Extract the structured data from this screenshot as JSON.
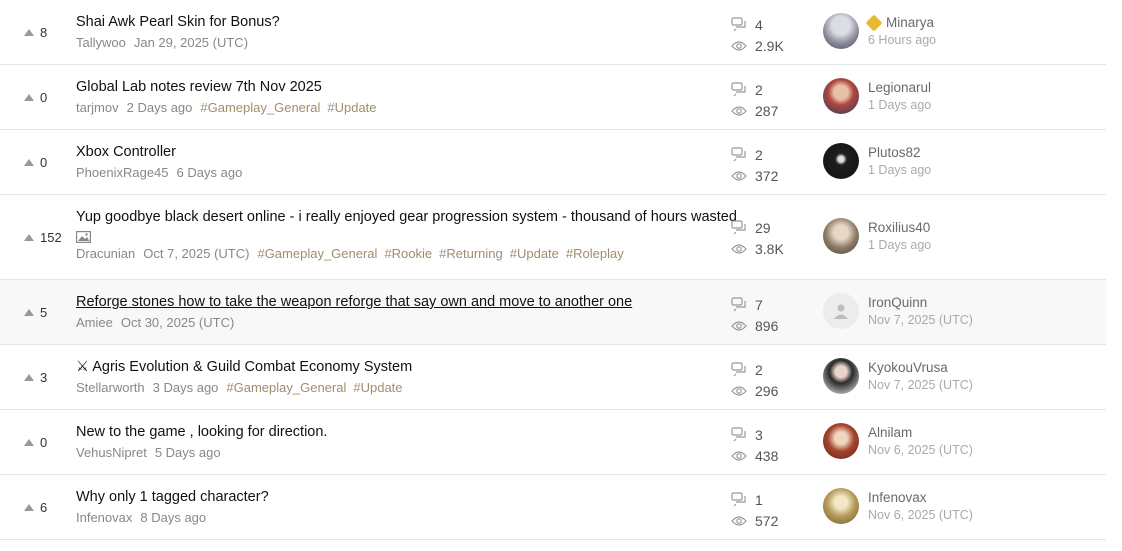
{
  "colors": {
    "tag": "#a08d6d",
    "badge": "#e8b932"
  },
  "threads": [
    {
      "votes": "8",
      "title": "Shai Awk Pearl Skin for Bonus?",
      "author": "Tallywoo",
      "date": "Jan 29, 2025 (UTC)",
      "tags": [],
      "replies": "4",
      "views": "2.9K",
      "last_user": "Minarya",
      "last_time": "6 Hours ago",
      "badge": true,
      "avatar": "#8a8a9a"
    },
    {
      "votes": "0",
      "title": "Global Lab notes review 7th Nov 2025",
      "author": "tarjmov",
      "date": "2 Days ago",
      "tags": [
        "#Gameplay_General",
        "#Update"
      ],
      "replies": "2",
      "views": "287",
      "last_user": "Legionarul",
      "last_time": "1 Days ago",
      "badge": false,
      "avatar": "#b0473c"
    },
    {
      "votes": "0",
      "title": "Xbox Controller",
      "author": "PhoenixRage45",
      "date": "6 Days ago",
      "tags": [],
      "replies": "2",
      "views": "372",
      "last_user": "Plutos82",
      "last_time": "1 Days ago",
      "badge": false,
      "avatar": "#1e1e1e"
    },
    {
      "votes": "152",
      "title": "Yup goodbye black desert online - i really enjoyed gear progression system - thousand of hours wasted",
      "author": "Dracunian",
      "date": "Oct 7, 2025 (UTC)",
      "tags": [
        "#Gameplay_General",
        "#Rookie",
        "#Returning",
        "#Update",
        "#Roleplay"
      ],
      "replies": "29",
      "views": "3.8K",
      "last_user": "Roxilius40",
      "last_time": "1 Days ago",
      "badge": false,
      "avatar": "#8d7a66"
    },
    {
      "votes": "5",
      "title": "Reforge stones how to take the weapon reforge that say own and move to another one",
      "author": "Amiee",
      "date": "Oct 30, 2025 (UTC)",
      "tags": [],
      "replies": "7",
      "views": "896",
      "last_user": "IronQuinn",
      "last_time": "Nov 7, 2025 (UTC)",
      "badge": false,
      "avatar": "default"
    },
    {
      "votes": "3",
      "title": "⚔ Agris Evolution & Guild Combat Economy System",
      "author": "Stellarworth",
      "date": "3 Days ago",
      "tags": [
        "#Gameplay_General",
        "#Update"
      ],
      "replies": "2",
      "views": "296",
      "last_user": "KyokouVrusa",
      "last_time": "Nov 7, 2025 (UTC)",
      "badge": false,
      "avatar": "#2a2a2a"
    },
    {
      "votes": "0",
      "title": "New to the game , looking for direction.",
      "author": "VehusNipret",
      "date": "5 Days ago",
      "tags": [],
      "replies": "3",
      "views": "438",
      "last_user": "Alnilam",
      "last_time": "Nov 6, 2025 (UTC)",
      "badge": false,
      "avatar": "#a5452e"
    },
    {
      "votes": "6",
      "title": "Why only 1 tagged character?",
      "author": "Infenovax",
      "date": "8 Days ago",
      "tags": [],
      "replies": "1",
      "views": "572",
      "last_user": "Infenovax",
      "last_time": "Nov 6, 2025 (UTC)",
      "badge": false,
      "avatar": "#b69a5a"
    }
  ]
}
